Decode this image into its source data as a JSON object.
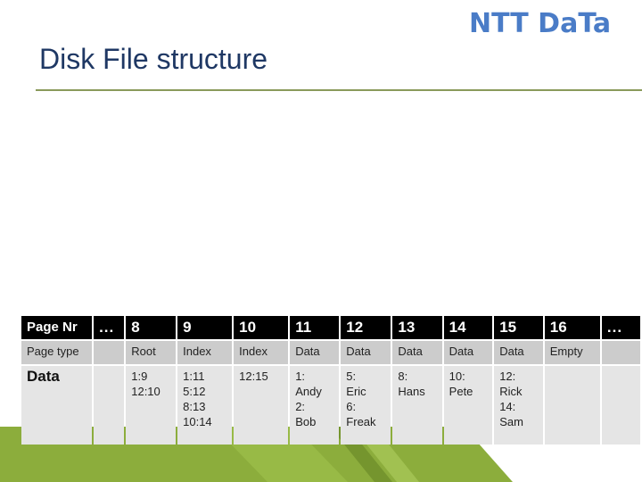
{
  "brand": {
    "logo_text": "NTT DaTa",
    "accent_color": "#4a7cc7",
    "band_color": "#8cad3c"
  },
  "slide": {
    "title": "Disk File structure"
  },
  "table": {
    "row_labels": {
      "page_nr": "Page Nr",
      "page_type": "Page type",
      "data": "Data"
    },
    "gap_marker": "...",
    "columns": [
      {
        "page": "...",
        "type": "",
        "data": []
      },
      {
        "page": "8",
        "type": "Root",
        "data": [
          "1:9",
          "12:10"
        ]
      },
      {
        "page": "9",
        "type": "Index",
        "data": [
          "1:11",
          "5:12",
          "8:13",
          "10:14"
        ]
      },
      {
        "page": "10",
        "type": "Index",
        "data": [
          "12:15"
        ]
      },
      {
        "page": "11",
        "type": "Data",
        "data": [
          "1:",
          "Andy",
          "2:",
          "Bob"
        ]
      },
      {
        "page": "12",
        "type": "Data",
        "data": [
          "5:",
          "Eric",
          "6:",
          "Freak"
        ]
      },
      {
        "page": "13",
        "type": "Data",
        "data": [
          "8:",
          "Hans"
        ]
      },
      {
        "page": "14",
        "type": "Data",
        "data": [
          "10:",
          "Pete"
        ]
      },
      {
        "page": "15",
        "type": "Data",
        "data": [
          "12:",
          "Rick",
          "14:",
          "Sam"
        ]
      },
      {
        "page": "16",
        "type": "Empty",
        "data": []
      },
      {
        "page": "...",
        "type": "",
        "data": []
      }
    ]
  }
}
